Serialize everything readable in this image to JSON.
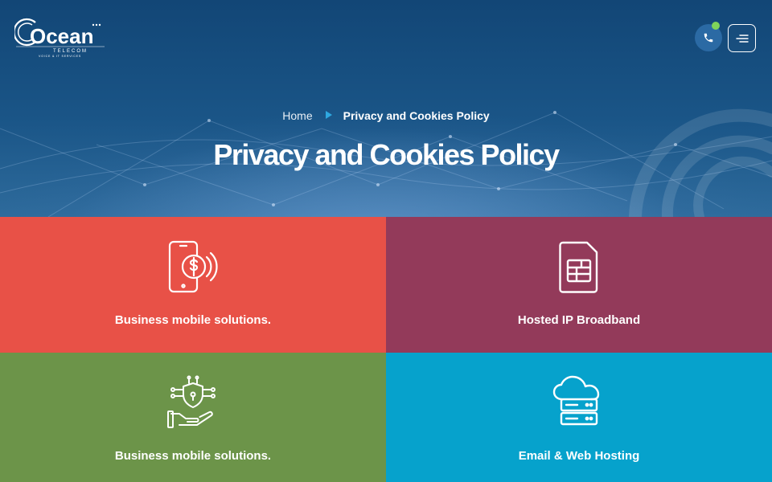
{
  "brand": {
    "name": "Ocean",
    "sub": "TELECOM",
    "tagline": "VOICE & IT SERVICES"
  },
  "header": {
    "phone_icon": "phone-icon",
    "menu_icon": "hamburger-menu-icon",
    "status_color": "#7fd35a"
  },
  "breadcrumb": {
    "home": "Home",
    "current": "Privacy and Cookies Policy"
  },
  "page_title": "Privacy and Cookies Policy",
  "tiles": [
    {
      "label": "Business mobile solutions.",
      "icon": "mobile-payment-icon",
      "color": "#e85147"
    },
    {
      "label": "Hosted IP Broadband",
      "icon": "sim-card-icon",
      "color": "#933a5a"
    },
    {
      "label": "Business mobile solutions.",
      "icon": "shield-hand-security-icon",
      "color": "#6c9449"
    },
    {
      "label": "Email & Web Hosting",
      "icon": "cloud-server-icon",
      "color": "#06a2cc"
    }
  ]
}
